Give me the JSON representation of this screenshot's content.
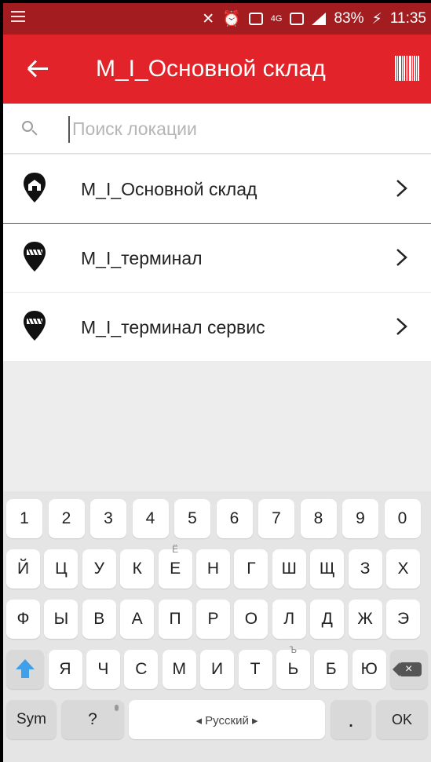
{
  "status_bar": {
    "battery": "83%",
    "time": "11:35",
    "network": "4G"
  },
  "app_bar": {
    "title": "М_I_Основной склад",
    "back_icon": "arrow-left-icon",
    "action_icon": "barcode-icon"
  },
  "search": {
    "placeholder": "Поиск локации",
    "value": ""
  },
  "locations": [
    {
      "label": "М_I_Основной склад",
      "icon": "warehouse-pin-icon",
      "selected": true
    },
    {
      "label": "М_I_терминал",
      "icon": "terminal-pin-icon",
      "selected": false
    },
    {
      "label": "М_I_терминал сервис",
      "icon": "terminal-pin-icon",
      "selected": false
    }
  ],
  "keyboard": {
    "digits": [
      "1",
      "2",
      "3",
      "4",
      "5",
      "6",
      "7",
      "8",
      "9",
      "0"
    ],
    "row1": [
      "Й",
      "Ц",
      "У",
      "К",
      "Е",
      "Н",
      "Г",
      "Ш",
      "Щ",
      "З",
      "Х"
    ],
    "row1_secondary": {
      "Е": "Ё"
    },
    "row2": [
      "Ф",
      "Ы",
      "В",
      "А",
      "П",
      "Р",
      "О",
      "Л",
      "Д",
      "Ж",
      "Э"
    ],
    "row3": [
      "Я",
      "Ч",
      "С",
      "М",
      "И",
      "Т",
      "Ь",
      "Б",
      "Ю"
    ],
    "row3_secondary": {
      "Ь": "Ъ"
    },
    "sym": "Sym",
    "question": "?",
    "language": "◂ Русский ▸",
    "period": ".",
    "ok": "OK"
  },
  "colors": {
    "app_bar": "#e3232a",
    "status_bar": "#a31c20",
    "shift": "#3f9fe8"
  }
}
